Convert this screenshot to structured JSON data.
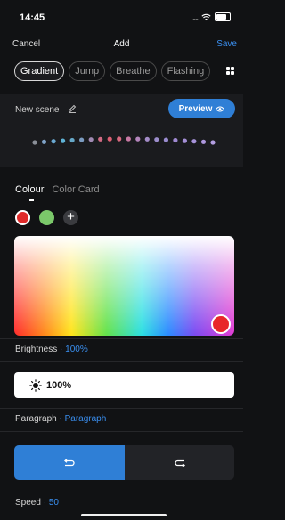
{
  "status": {
    "time": "14:45",
    "dots": "....",
    "icons": [
      "wifi-icon",
      "battery-icon"
    ]
  },
  "nav": {
    "cancel": "Cancel",
    "title": "Add",
    "save": "Save"
  },
  "tabs": [
    {
      "label": "Gradient",
      "active": true
    },
    {
      "label": "Jump",
      "active": false
    },
    {
      "label": "Breathe",
      "active": false
    },
    {
      "label": "Flashing",
      "active": false
    }
  ],
  "scene": {
    "name": "New scene",
    "preview_label": "Preview"
  },
  "lamp_colors": [
    "#8a8f98",
    "#7fa3c8",
    "#6aa9d2",
    "#5fb3d6",
    "#66a8c8",
    "#7b9bc0",
    "#a08ab3",
    "#d26b84",
    "#dd5f73",
    "#d86a80",
    "#c879a4",
    "#b586bd",
    "#a48cc8",
    "#9c8dcc",
    "#9a8cd0",
    "#a08ad2",
    "#a48fd6",
    "#a793da",
    "#ae98de",
    "#b39ee1"
  ],
  "colour": {
    "tab_colour": "Colour",
    "tab_card": "Color Card",
    "swatches": [
      "#e02a2a",
      "#7bc86a"
    ],
    "add_symbol": "+",
    "selected_color": "#e8262a"
  },
  "brightness": {
    "label": "Brightness",
    "separator": "·",
    "value": "100%",
    "field_value": "100%"
  },
  "paragraph": {
    "label": "Paragraph",
    "separator": "·",
    "value": "Paragraph"
  },
  "direction": {
    "selected": "left"
  },
  "speed": {
    "label": "Speed",
    "separator": "·",
    "value": "50"
  },
  "colors": {
    "accent": "#2f7fd6",
    "link": "#3a8ff0"
  }
}
